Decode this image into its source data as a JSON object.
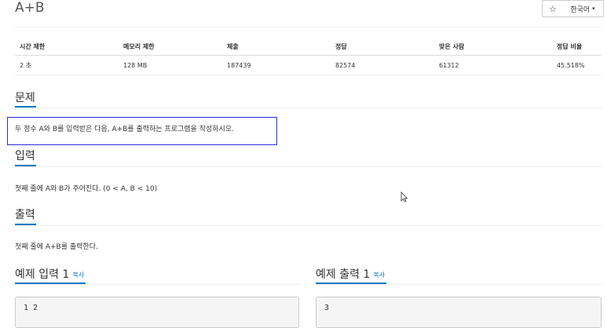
{
  "title": "A+B",
  "header": {
    "star_glyph": "☆",
    "language": "한국어",
    "caret": "▾"
  },
  "info_table": {
    "headers": [
      "시간 제한",
      "메모리 제한",
      "제출",
      "정답",
      "맞은 사람",
      "정답 비율"
    ],
    "row": [
      "2 초",
      "128 MB",
      "187439",
      "82574",
      "61312",
      "45.518%"
    ]
  },
  "sections": {
    "problem": {
      "title": "문제",
      "text": "두 정수 A와 B를 입력받은 다음, A+B를 출력하는 프로그램을 작성하시오."
    },
    "input": {
      "title": "입력",
      "text": "첫째 줄에 A와 B가 주어진다. (0 < A, B < 10)"
    },
    "output": {
      "title": "출력",
      "text": "첫째 줄에 A+B를 출력한다."
    }
  },
  "samples": {
    "input": {
      "title": "예제 입력 1",
      "copy": "복사",
      "value": "1 2"
    },
    "output": {
      "title": "예제 출력 1",
      "copy": "복사",
      "value": "3"
    }
  },
  "colors": {
    "accent": "#0076c0",
    "highlight": "#2b2bd6"
  }
}
